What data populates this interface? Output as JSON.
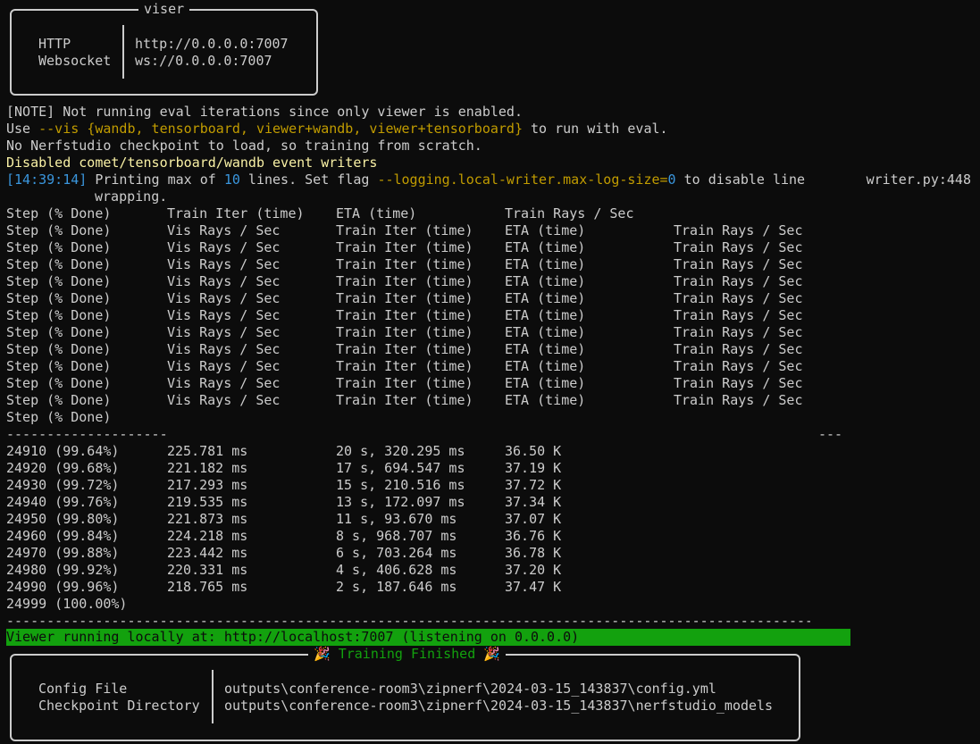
{
  "viser_box": {
    "title": "viser",
    "http_label": "HTTP",
    "ws_label": "Websocket",
    "http_value": "http://0.0.0.0:7007",
    "ws_value": "ws://0.0.0.0:7007"
  },
  "log": {
    "note_tag": "[NOTE]",
    "note_text": " Not running eval iterations since only viewer is enabled.",
    "use_prefix": "Use ",
    "vis_flag": "--vis",
    "vis_options": "{wandb, tensorboard, viewer+wandb, viewer+tensorboard}",
    "use_suffix": " to run with eval.",
    "no_checkpoint": "No Nerfstudio checkpoint to load, so training from scratch.",
    "disabled_writers": "Disabled comet/tensorboard/wandb event writers",
    "timestamp": "[14:39:14]",
    "printing_a": " Printing max of ",
    "printing_num": "10",
    "printing_b": " lines. Set flag ",
    "printing_flag": "--logging.local-writer.max-log-size=",
    "printing_zero": "0",
    "printing_c": " to disable line",
    "printing_wrap": "wrapping.",
    "writer_ref": "writer.py:448"
  },
  "header_rows": {
    "first": [
      "Step (% Done)",
      "Train Iter (time)",
      "ETA (time)",
      "Train Rays / Sec"
    ],
    "repeat": [
      "Step (% Done)",
      "Vis Rays / Sec",
      "Train Iter (time)",
      "ETA (time)",
      "Train Rays / Sec"
    ],
    "repeat_count": 11,
    "last": "Step (% Done)"
  },
  "separator_short": "--------------------",
  "separator_tail": "---",
  "table": {
    "rows": [
      [
        "24910 (99.64%)",
        "225.781 ms",
        "20 s, 320.295 ms",
        "36.50 K"
      ],
      [
        "24920 (99.68%)",
        "221.182 ms",
        "17 s, 694.547 ms",
        "37.19 K"
      ],
      [
        "24930 (99.72%)",
        "217.293 ms",
        "15 s, 210.516 ms",
        "37.72 K"
      ],
      [
        "24940 (99.76%)",
        "219.535 ms",
        "13 s, 172.097 ms",
        "37.34 K"
      ],
      [
        "24950 (99.80%)",
        "221.873 ms",
        "11 s, 93.670 ms",
        "37.07 K"
      ],
      [
        "24960 (99.84%)",
        "224.218 ms",
        "8 s, 968.707 ms",
        "36.76 K"
      ],
      [
        "24970 (99.88%)",
        "223.442 ms",
        "6 s, 703.264 ms",
        "36.78 K"
      ],
      [
        "24980 (99.92%)",
        "220.331 ms",
        "4 s, 406.628 ms",
        "37.20 K"
      ],
      [
        "24990 (99.96%)",
        "218.765 ms",
        "2 s, 187.646 ms",
        "37.47 K"
      ]
    ],
    "final": "24999 (100.00%)"
  },
  "separator_long": "----------------------------------------------------------------------------------------------------",
  "viewer_banner": "Viewer running locally at: http://localhost:7007 (listening on 0.0.0.0)",
  "finished_box": {
    "title": "🎉 Training Finished 🎉",
    "config_label": "Config File",
    "checkpoint_label": "Checkpoint Directory",
    "config_value": "outputs\\conference-room3\\zipnerf\\2024-03-15_143837\\config.yml",
    "checkpoint_value": "outputs\\conference-room3\\zipnerf\\2024-03-15_143837\\nerfstudio_models"
  },
  "colors": {
    "background": "#0c0c0c",
    "foreground": "#cccccc",
    "banner_green": "#13a10e",
    "timestamp_blue": "#3a96dd",
    "flag_gold": "#c19c00"
  }
}
